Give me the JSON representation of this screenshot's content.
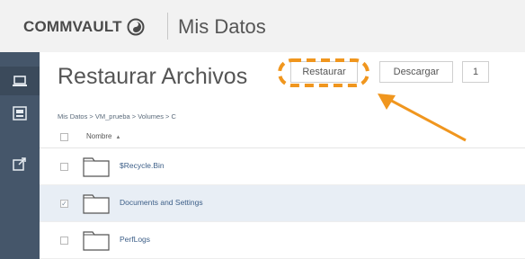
{
  "header": {
    "logo_text": "COMMVAULT",
    "app_title": "Mis Datos"
  },
  "nav": {
    "items": [
      {
        "icon": "laptop-icon"
      },
      {
        "icon": "server-icon"
      },
      {
        "icon": "share-icon"
      }
    ]
  },
  "main": {
    "title": "Restaurar Archivos",
    "buttons": {
      "restore": "Restaurar",
      "download": "Descargar",
      "more": "1"
    },
    "breadcrumb": "Mis Datos > VM_prueba > Volumes > C",
    "table": {
      "column_name": "Nombre",
      "rows": [
        {
          "name": "$Recycle.Bin",
          "checked": false
        },
        {
          "name": "Documents and Settings",
          "checked": true
        },
        {
          "name": "PerfLogs",
          "checked": false
        }
      ]
    }
  },
  "colors": {
    "nav_bg": "#45566a",
    "highlight": "#f0961e",
    "link": "#3d5f88"
  }
}
